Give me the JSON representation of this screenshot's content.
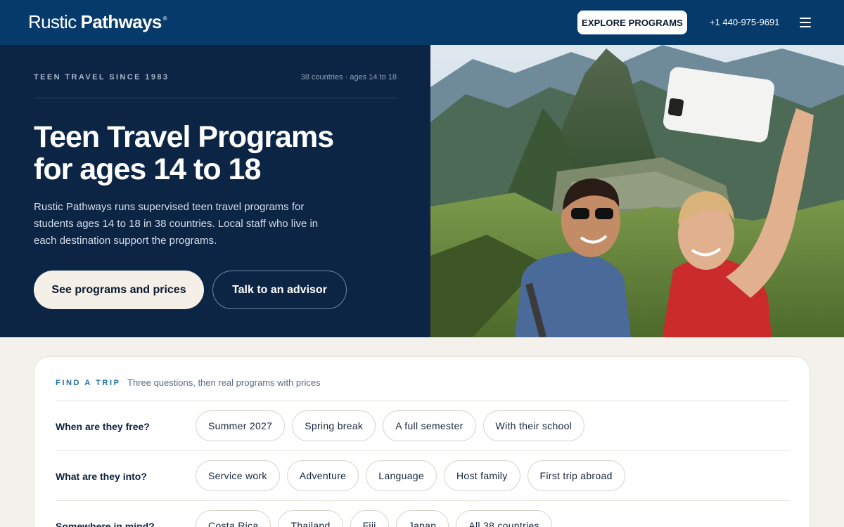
{
  "header": {
    "logo_light": "Rustic",
    "logo_bold": "Pathways",
    "logo_reg": "®",
    "explore_label": "EXPLORE PROGRAMS",
    "phone": "+1 440-975-9691",
    "bg_color": "#063a6b"
  },
  "hero": {
    "eyebrow": "TEEN TRAVEL SINCE 1983",
    "meta": "38 countries · ages 14 to 18",
    "title_line1": "Teen Travel Programs",
    "title_line2": "for ages 14 to 18",
    "description": "Rustic Pathways runs supervised teen travel programs for students ages 14 to 18 in 38 countries. Local staff who live in each destination support the programs.",
    "primary_cta": "See programs and prices",
    "secondary_cta": "Talk to an advisor",
    "bg_color": "#0c2545"
  },
  "finder": {
    "label": "FIND A TRIP",
    "subtitle": "Three questions, then real programs with prices",
    "rows": [
      {
        "question": "When are they free?",
        "options": [
          "Summer 2027",
          "Spring break",
          "A full semester",
          "With their school"
        ]
      },
      {
        "question": "What are they into?",
        "options": [
          "Service work",
          "Adventure",
          "Language",
          "Host family",
          "First trip abroad"
        ]
      },
      {
        "question": "Somewhere in mind?",
        "options": [
          "Costa Rica",
          "Thailand",
          "Fiji",
          "Japan",
          "All 38 countries"
        ]
      }
    ]
  }
}
